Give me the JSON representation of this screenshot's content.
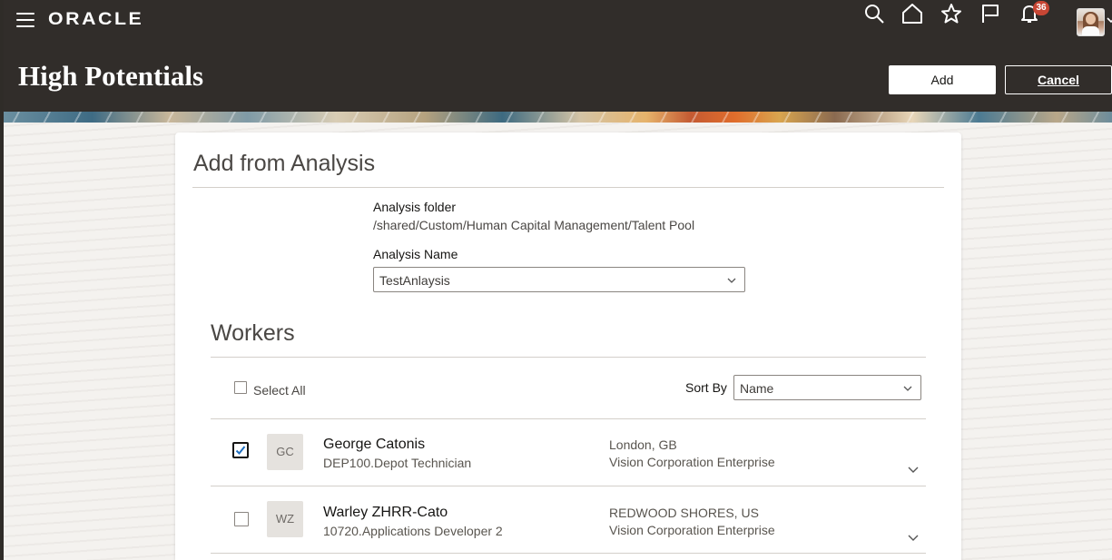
{
  "header": {
    "logo_text": "ORACLE",
    "notification_count": "36",
    "page_title": "High Potentials",
    "add_label": "Add",
    "cancel_label": "Cancel",
    "icons": [
      "menu-icon",
      "search-icon",
      "home-icon",
      "star-icon",
      "flag-icon",
      "bell-icon",
      "user-avatar",
      "chevron-down-icon"
    ],
    "colors": {
      "header_bg": "#312d2a",
      "badge": "#c74634"
    }
  },
  "card": {
    "title": "Add from Analysis",
    "analysis_folder_label": "Analysis folder",
    "analysis_folder_value": "/shared/Custom/Human Capital Management/Talent Pool",
    "analysis_name_label": "Analysis Name",
    "analysis_name_value": "TestAnlaysis"
  },
  "workers": {
    "title": "Workers",
    "select_all_label": "Select All",
    "sort_by_label": "Sort By",
    "sort_by_value": "Name",
    "rows": [
      {
        "checked": true,
        "initials": "GC",
        "name": "George Catonis",
        "job": "DEP100.Depot Technician",
        "location": "London, GB",
        "enterprise": "Vision Corporation Enterprise"
      },
      {
        "checked": false,
        "initials": "WZ",
        "name": "Warley ZHRR-Cato",
        "job": "10720.Applications Developer 2",
        "location": "REDWOOD SHORES, US",
        "enterprise": "Vision Corporation Enterprise"
      }
    ]
  }
}
